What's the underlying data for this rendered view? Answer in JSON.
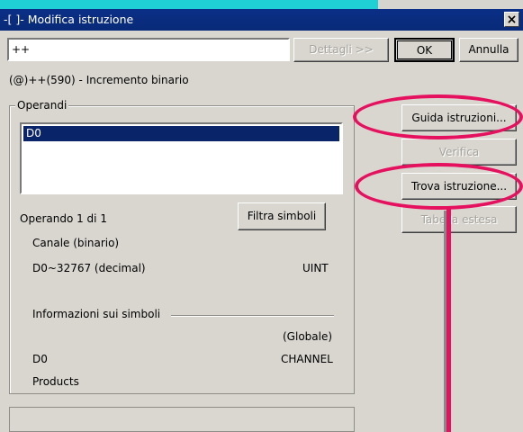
{
  "window": {
    "title": "-[ ]- Modifica istruzione",
    "close_label": "×"
  },
  "top": {
    "instruction_value": "++",
    "details_label": "Dettagli >>",
    "ok_label": "OK",
    "cancel_label": "Annulla"
  },
  "description": "(@)++(590) - Incremento binario",
  "operands": {
    "group_label": "Operandi",
    "list": [
      "D0"
    ],
    "counter": "Operando 1 di 1",
    "filter_label": "Filtra simboli",
    "type_text": "Canale (binario)",
    "range_text": "D0~32767 (decimal)",
    "data_type": "UINT",
    "symbol_info_label": "Informazioni sui simboli",
    "scope": "(Globale)",
    "symbol_name": "D0",
    "symbol_kind": "CHANNEL",
    "symbol_comment": "Products"
  },
  "side_buttons": {
    "help_label": "Guida istruzioni...",
    "verify_label": "Verifica",
    "find_label": "Trova istruzione...",
    "table_label": "Tabella estesa"
  },
  "colors": {
    "highlight": "#e5105e",
    "title_bar": "#0b2f86",
    "selection": "#0a246a",
    "background": "#1fd0d4"
  }
}
